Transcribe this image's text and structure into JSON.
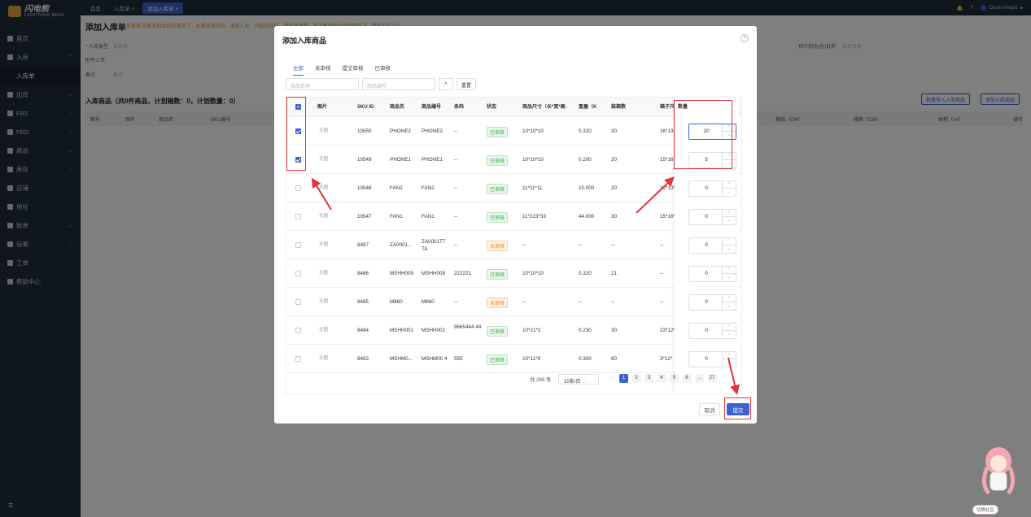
{
  "sidebar": {
    "logo_text": "闪电熊",
    "logo_sub": "LIGHTNING BEAR",
    "items": [
      {
        "label": "首页",
        "icon": "home-icon",
        "chev": ""
      },
      {
        "label": "入库",
        "icon": "inbound-icon",
        "chev": "^"
      },
      {
        "label": "入库单",
        "icon": "",
        "chev": "",
        "sub": true
      },
      {
        "label": "出库",
        "icon": "outbound-icon",
        "chev": "v"
      },
      {
        "label": "FBS",
        "icon": "fbs-icon",
        "chev": "v"
      },
      {
        "label": "FBO",
        "icon": "fbo-icon",
        "chev": "v"
      },
      {
        "label": "商品",
        "icon": "goods-icon",
        "chev": "v"
      },
      {
        "label": "库存",
        "icon": "stock-icon",
        "chev": "v"
      },
      {
        "label": "店铺",
        "icon": "shop-icon",
        "chev": ""
      },
      {
        "label": "地址",
        "icon": "address-icon",
        "chev": ""
      },
      {
        "label": "账单",
        "icon": "bill-icon",
        "chev": "v"
      },
      {
        "label": "设置",
        "icon": "settings-icon",
        "chev": "v"
      },
      {
        "label": "工单",
        "icon": "ticket-icon",
        "chev": ""
      },
      {
        "label": "帮助中心",
        "icon": "help-icon",
        "chev": ""
      }
    ]
  },
  "topbar": {
    "tabs": [
      "首页",
      "入库单 ×",
      "添加入库单 ×"
    ],
    "user": "Ozon-shop1"
  },
  "page": {
    "title": "添加入库单",
    "notice": "注意事项  在有采购合同的情况下，如遇到到只员，请先入库，只能驳回的，请不要调整，若没有采购合同的情况下，请务必先入库。",
    "type_label": "* 入库类型",
    "type_placeholder": "请选择",
    "upload_label": "附件上传",
    "note_label": "备注",
    "note_placeholder": "备注",
    "date_label": "预计到达(仓)日期",
    "date_placeholder": "选择日期",
    "section_title": "入库商品（共0件商品，计划箱数：0，计划数量：0）",
    "batch_btn": "批量导入入库商品",
    "add_btn": "添加入库商品",
    "headers": [
      "箱号",
      "图片",
      "商品名",
      "SKU编号",
      "箱规（CM）",
      "箱高（CM）",
      "体积（m³）",
      "操作"
    ]
  },
  "modal": {
    "title": "添加入库商品",
    "tabs": [
      "全部",
      "未审核",
      "提交审核",
      "已审核"
    ],
    "name_placeholder": "商品名称",
    "code_placeholder": "商品编号",
    "reset_label": "重置",
    "columns": [
      "图片",
      "SKU ID",
      "商品名",
      "商品编号",
      "条码",
      "状态",
      "商品尺寸（长*宽*高-",
      "重量（K",
      "装箱数",
      "箱子尺",
      "数量"
    ],
    "rows": [
      {
        "checked": true,
        "img": "无图",
        "sku": "10550",
        "name": "PHONE2",
        "code": "PHONE2",
        "barcode": "--",
        "status": "已审核",
        "ok": true,
        "size": "10*10*10",
        "weight": "0.320",
        "box": "30",
        "box_size": "16*13*",
        "qty": "20"
      },
      {
        "checked": true,
        "img": "无图",
        "sku": "10549",
        "name": "PHONE1",
        "code": "PHONE1",
        "barcode": "--",
        "status": "已审核",
        "ok": true,
        "size": "10*10*10",
        "weight": "0.200",
        "box": "20",
        "box_size": "15*16*",
        "qty": "5"
      },
      {
        "checked": false,
        "img": "无图",
        "sku": "10548",
        "name": "FAN2",
        "code": "FAN2",
        "barcode": "--",
        "status": "已审核",
        "ok": true,
        "size": "11*11*11",
        "weight": "10.000",
        "box": "20",
        "box_size": "16*13*",
        "qty": "0"
      },
      {
        "checked": false,
        "img": "无图",
        "sku": "10547",
        "name": "FAN1",
        "code": "FAN1",
        "barcode": "--",
        "status": "已审核",
        "ok": true,
        "size": "11*223*33",
        "weight": "44.000",
        "box": "30",
        "box_size": "15*16*",
        "qty": "0"
      },
      {
        "checked": false,
        "img": "无图",
        "sku": "8487",
        "name": "ZA0001...",
        "code": "ZA0001TT TA",
        "barcode": "--",
        "status": "未审核",
        "ok": false,
        "size": "--",
        "weight": "--",
        "box": "--",
        "box_size": "--",
        "qty": "0"
      },
      {
        "checked": false,
        "img": "无图",
        "sku": "8486",
        "name": "MSHH009",
        "code": "MSHH009",
        "barcode": "222221",
        "status": "已审核",
        "ok": true,
        "size": "10*10*10",
        "weight": "0.320",
        "box": "21",
        "box_size": "--",
        "qty": "0"
      },
      {
        "checked": false,
        "img": "无图",
        "sku": "8485",
        "name": "M860",
        "code": "M860",
        "barcode": "--",
        "status": "未审核",
        "ok": false,
        "size": "--",
        "weight": "--",
        "box": "--",
        "box_size": "--",
        "qty": "0"
      },
      {
        "checked": false,
        "img": "无图",
        "sku": "8484",
        "name": "MSHH001",
        "code": "MSHH001",
        "barcode": "9665444 44",
        "status": "已审核",
        "ok": true,
        "size": "10*21*2",
        "weight": "0.230",
        "box": "30",
        "box_size": "23*12*",
        "qty": "0"
      },
      {
        "checked": false,
        "img": "无图",
        "sku": "8483",
        "name": "MSHM0...",
        "code": "MSHM00 4",
        "barcode": "555",
        "status": "已审核",
        "ok": true,
        "size": "10*11*9",
        "weight": "0.300",
        "box": "60",
        "box_size": "3*12*",
        "qty": "0"
      }
    ],
    "total": "共 268 条",
    "page_size": "10条/页",
    "pages": [
      "1",
      "2",
      "3",
      "4",
      "5",
      "6",
      "...",
      "27"
    ],
    "cancel_label": "取消",
    "submit_label": "提交"
  },
  "mascot_caption": "切换社区",
  "colors": {
    "accent": "#3d62d6",
    "annotation": "#e3343a",
    "ok": "#3aaa4b",
    "warn": "#e88a1a"
  }
}
